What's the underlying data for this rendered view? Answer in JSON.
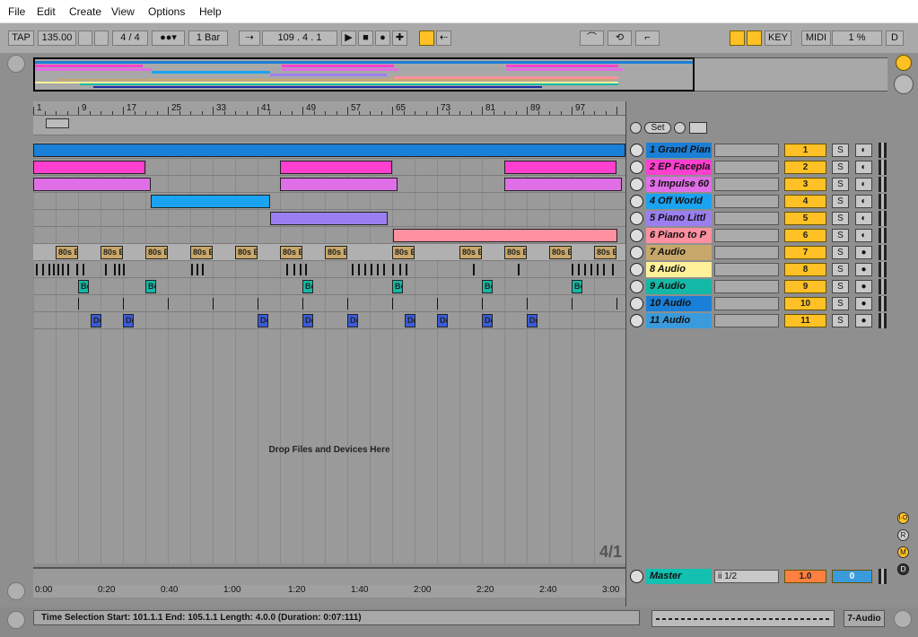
{
  "menu": [
    "File",
    "Edit",
    "Create",
    "View",
    "Options",
    "Help"
  ],
  "control": {
    "tap": "TAP",
    "tempo": "135.00",
    "signature": "4 / 4",
    "quantize": "1 Bar",
    "position": "109 .  4 .  1",
    "key": "KEY",
    "midi": "MIDI",
    "cpu": "1 %",
    "d": "D"
  },
  "ruler_labels": [
    "1",
    "9",
    "17",
    "25",
    "33",
    "41",
    "49",
    "57",
    "65",
    "73",
    "81",
    "89",
    "97"
  ],
  "time_labels": [
    "0:00",
    "0:20",
    "0:40",
    "1:00",
    "1:20",
    "1:40",
    "2:00",
    "2:20",
    "2:40",
    "3:00"
  ],
  "set_label": "Set",
  "loop_label": "4/1",
  "clip_label_80s": "80s E",
  "clip_label_be": "Be",
  "clip_label_de": "De",
  "drop_text": "Drop Files and Devices Here",
  "tracks": [
    {
      "name": "1 Grand Pian",
      "num": "1",
      "color": "#1a7fd6",
      "arm": "◐"
    },
    {
      "name": "2 EP Facepla",
      "num": "2",
      "color": "#ff3fd0",
      "arm": "◐"
    },
    {
      "name": "3 Impulse 60",
      "num": "3",
      "color": "#e06ee6",
      "arm": "◐"
    },
    {
      "name": "4 Off World",
      "num": "4",
      "color": "#1aa3f0",
      "arm": "◐"
    },
    {
      "name": "5 Piano Littl",
      "num": "5",
      "color": "#9b7ff0",
      "arm": "◐"
    },
    {
      "name": "6 Piano to P",
      "num": "6",
      "color": "#ff90a0",
      "arm": "◐"
    },
    {
      "name": "7 Audio",
      "num": "7",
      "color": "#c8a86a",
      "arm": "●"
    },
    {
      "name": "8 Audio",
      "num": "8",
      "color": "#fff199",
      "arm": "●"
    },
    {
      "name": "9 Audio",
      "num": "9",
      "color": "#14b8a6",
      "arm": "●"
    },
    {
      "name": "10 Audio",
      "num": "10",
      "color": "#1a7fd6",
      "arm": "●"
    },
    {
      "name": "11 Audio",
      "num": "11",
      "color": "#3a9bdc",
      "arm": "●"
    }
  ],
  "master": {
    "name": "Master",
    "select": "ii 1/2",
    "vol": "1.0",
    "pan": "0",
    "color": "#14c0b0"
  },
  "solo_label": "S",
  "status": {
    "text": "Time Selection    Start: 101.1.1    End: 105.1.1    Length: 4.0.0  (Duration: 0:07:111)",
    "track": "7-Audio"
  },
  "right_buttons": [
    "I·O",
    "R",
    "M",
    "D"
  ]
}
